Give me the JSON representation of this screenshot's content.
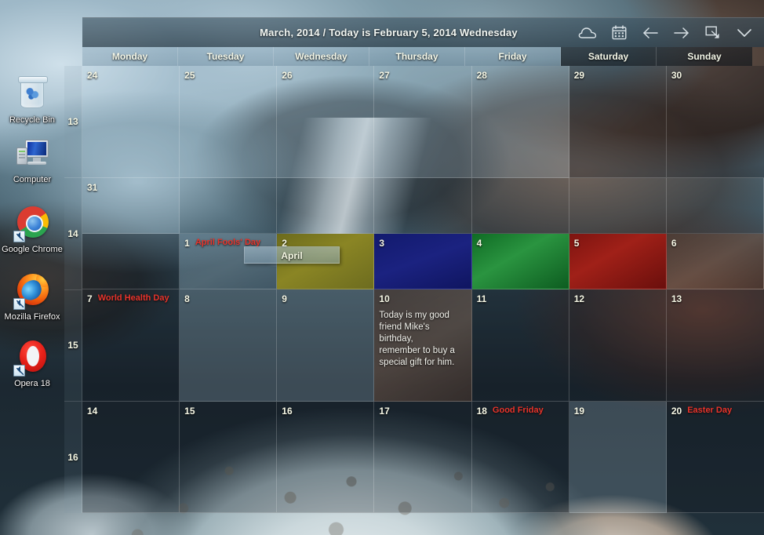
{
  "desktop": {
    "icons": [
      {
        "name": "recycle-bin",
        "label": "Recycle Bin",
        "shortcut": false
      },
      {
        "name": "computer",
        "label": "Computer",
        "shortcut": false
      },
      {
        "name": "google-chrome",
        "label": "Google\nChrome",
        "shortcut": true
      },
      {
        "name": "mozilla-firefox",
        "label": "Mozilla\nFirefox",
        "shortcut": true
      },
      {
        "name": "opera-18",
        "label": "Opera 18",
        "shortcut": true
      }
    ]
  },
  "calendar": {
    "title": "March, 2014 / Today is February 5, 2014 Wednesday",
    "month_tooltip": "April",
    "toolbar": [
      {
        "name": "cloud-icon",
        "label": "cloud"
      },
      {
        "name": "calendar-icon",
        "label": "calendar"
      },
      {
        "name": "arrow-left-icon",
        "label": "previous"
      },
      {
        "name": "arrow-right-icon",
        "label": "next"
      },
      {
        "name": "screenshot-icon",
        "label": "capture"
      },
      {
        "name": "chevron-down-icon",
        "label": "collapse"
      }
    ],
    "weekdays": [
      {
        "label": "Monday",
        "weekend": false
      },
      {
        "label": "Tuesday",
        "weekend": false
      },
      {
        "label": "Wednesday",
        "weekend": false
      },
      {
        "label": "Thursday",
        "weekend": false
      },
      {
        "label": "Friday",
        "weekend": false
      },
      {
        "label": "Saturday",
        "weekend": true
      },
      {
        "label": "Sunday",
        "weekend": true
      }
    ],
    "week_numbers": [
      "13",
      "14",
      "15",
      "16"
    ],
    "holiday_color": "#e8342b",
    "weeks": [
      {
        "week": "13",
        "days": [
          {
            "num": "24",
            "holiday": "",
            "note": "",
            "tint": "tint-light",
            "swatch": ""
          },
          {
            "num": "25",
            "holiday": "",
            "note": "",
            "tint": "tint-light",
            "swatch": ""
          },
          {
            "num": "26",
            "holiday": "",
            "note": "",
            "tint": "tint-light",
            "swatch": ""
          },
          {
            "num": "27",
            "holiday": "",
            "note": "",
            "tint": "tint-light",
            "swatch": ""
          },
          {
            "num": "28",
            "holiday": "",
            "note": "",
            "tint": "tint-light",
            "swatch": ""
          },
          {
            "num": "29",
            "holiday": "",
            "note": "",
            "tint": "tint-dark",
            "swatch": ""
          },
          {
            "num": "30",
            "holiday": "",
            "note": "",
            "tint": "tint-dark",
            "swatch": ""
          }
        ]
      },
      {
        "week": "14",
        "days": [
          {
            "num": "31",
            "holiday": "",
            "note": "",
            "tint": "tint-light",
            "swatch": ""
          },
          {
            "num": "",
            "holiday": "",
            "note": "",
            "tint": "blank",
            "swatch": ""
          },
          {
            "num": "",
            "holiday": "",
            "note": "",
            "tint": "blank",
            "swatch": ""
          },
          {
            "num": "",
            "holiday": "",
            "note": "",
            "tint": "blank",
            "swatch": ""
          },
          {
            "num": "",
            "holiday": "",
            "note": "",
            "tint": "blank",
            "swatch": ""
          },
          {
            "num": "",
            "holiday": "",
            "note": "",
            "tint": "blank",
            "swatch": ""
          },
          {
            "num": "",
            "holiday": "",
            "note": "",
            "tint": "blank",
            "swatch": ""
          }
        ]
      },
      {
        "week": "14b",
        "days": [
          {
            "num": "",
            "holiday": "",
            "note": "",
            "tint": "tint-dark",
            "swatch": ""
          },
          {
            "num": "1",
            "holiday": "April Fools' Day",
            "note": "",
            "tint": "",
            "swatch": "sw-bluegrey"
          },
          {
            "num": "2",
            "holiday": "",
            "note": "",
            "tint": "",
            "swatch": "sw-olive"
          },
          {
            "num": "3",
            "holiday": "",
            "note": "",
            "tint": "",
            "swatch": "sw-navy"
          },
          {
            "num": "4",
            "holiday": "",
            "note": "",
            "tint": "",
            "swatch": "sw-green"
          },
          {
            "num": "5",
            "holiday": "",
            "note": "",
            "tint": "",
            "swatch": "sw-red"
          },
          {
            "num": "6",
            "holiday": "",
            "note": "",
            "tint": "",
            "swatch": "sw-brownstone"
          }
        ]
      },
      {
        "week": "15",
        "days": [
          {
            "num": "7",
            "holiday": "World Health Day",
            "note": "",
            "tint": "tint-dark",
            "swatch": ""
          },
          {
            "num": "8",
            "holiday": "",
            "note": "",
            "tint": "tint-light",
            "swatch": ""
          },
          {
            "num": "9",
            "holiday": "",
            "note": "",
            "tint": "tint-light",
            "swatch": ""
          },
          {
            "num": "10",
            "holiday": "",
            "note": "Today is my good\nfriend Mike's\nbirthday,\nremember to buy a\nspecial gift for him.",
            "tint": "",
            "swatch": "sw-brownstone"
          },
          {
            "num": "11",
            "holiday": "",
            "note": "",
            "tint": "tint-dark",
            "swatch": ""
          },
          {
            "num": "12",
            "holiday": "",
            "note": "",
            "tint": "tint-dark",
            "swatch": ""
          },
          {
            "num": "13",
            "holiday": "",
            "note": "",
            "tint": "tint-dark",
            "swatch": ""
          }
        ]
      },
      {
        "week": "16",
        "days": [
          {
            "num": "14",
            "holiday": "",
            "note": "",
            "tint": "tint-dark",
            "swatch": ""
          },
          {
            "num": "15",
            "holiday": "",
            "note": "",
            "tint": "tint-dark",
            "swatch": ""
          },
          {
            "num": "16",
            "holiday": "",
            "note": "",
            "tint": "tint-dark",
            "swatch": ""
          },
          {
            "num": "17",
            "holiday": "",
            "note": "",
            "tint": "tint-dark",
            "swatch": ""
          },
          {
            "num": "18",
            "holiday": "Good Friday",
            "note": "",
            "tint": "tint-dark",
            "swatch": ""
          },
          {
            "num": "19",
            "holiday": "",
            "note": "",
            "tint": "tint-light",
            "swatch": ""
          },
          {
            "num": "20",
            "holiday": "Easter Day",
            "note": "",
            "tint": "tint-dark",
            "swatch": ""
          }
        ]
      }
    ]
  }
}
